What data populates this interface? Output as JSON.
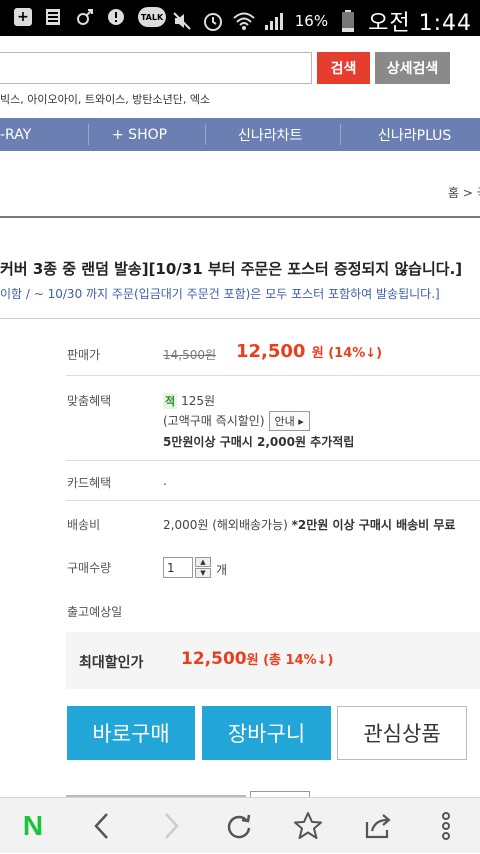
{
  "status_bar": {
    "battery_percent": "16%",
    "time": "오전 1:44",
    "talk_label": "TALK",
    "icons": [
      "add-icon",
      "sim-icon",
      "gender-icon",
      "alert-icon",
      "talk-icon",
      "mute-icon",
      "alarm-icon",
      "wifi-icon",
      "signal-icon",
      "battery-icon"
    ]
  },
  "search": {
    "placeholder": "",
    "search_button": "검색",
    "advanced_button": "상세검색",
    "popular_keywords": "빅스, 아이오아이, 트와이스, 방탄소년단, 엑소"
  },
  "nav": {
    "items": [
      "-RAY",
      "+ SHOP",
      "신나라차트",
      "신나라PLUS"
    ],
    "bg_color": "#6b7fb2"
  },
  "breadcrumb": "홈 > 국",
  "notice": {
    "title": "커버 3종 중 랜덤 발송][10/31 부터 주문은 포스터 증정되지 않습니다.]",
    "subtitle": "이함 / ~ 10/30 까지 주문(입금대기 주문건 포함)은 모두 포스터 포함하여 발송됩니다.]"
  },
  "product": {
    "price_label": "판매가",
    "original_price": "14,500원",
    "sale_price": "12,500",
    "sale_unit": "원 (14%↓)",
    "benefit_label": "맞춤혜택",
    "points_badge": "적",
    "points": "125원",
    "points_note": "(고액구매 즉시할인)",
    "guide_button": "안내 ▸",
    "points_extra": "5만원이상 구매시 2,000원 추가적립",
    "card_label": "카드혜택",
    "card_value": ".",
    "shipping_label": "배송비",
    "shipping_value": "2,000원 (해외배송가능) ",
    "shipping_note": "*2만원 이상 구매시 배송비 무료",
    "qty_label": "구매수량",
    "qty_value": "1",
    "qty_unit": "개",
    "release_label": "출고예상일",
    "release_value": "",
    "max_discount_label": "최대할인가",
    "max_discount_price": "12,500",
    "max_discount_unit": "원 (총 14%↓)",
    "accent_color": "#e8401c"
  },
  "actions": {
    "buy_now": "바로구매",
    "cart": "장바구니",
    "wishlist": "관심상품",
    "button_color": "#22a6d8"
  },
  "browser_bar": {
    "naver_logo": "N",
    "icons": [
      "back-icon",
      "forward-icon",
      "refresh-icon",
      "bookmark-star-icon",
      "share-icon",
      "more-menu-icon"
    ]
  }
}
